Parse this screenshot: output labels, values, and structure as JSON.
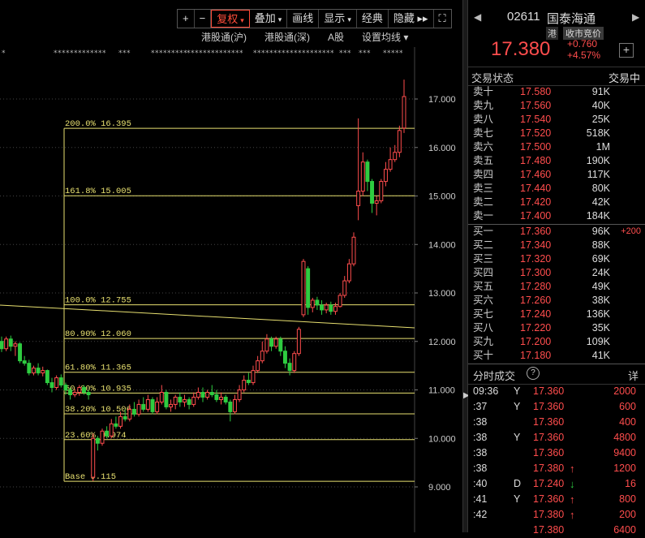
{
  "toolbar": {
    "items": [
      {
        "label": "+",
        "dropdown": false,
        "active": false,
        "name": "zoom-in-button"
      },
      {
        "label": "−",
        "dropdown": false,
        "active": false,
        "name": "zoom-out-button"
      },
      {
        "label": "复权",
        "dropdown": true,
        "active": true,
        "name": "adjust-button"
      },
      {
        "label": "叠加",
        "dropdown": true,
        "active": false,
        "name": "overlay-button"
      },
      {
        "label": "画线",
        "dropdown": false,
        "active": false,
        "name": "draw-button"
      },
      {
        "label": "显示",
        "dropdown": true,
        "active": false,
        "name": "display-button"
      },
      {
        "label": "经典",
        "dropdown": false,
        "active": false,
        "name": "classic-button"
      },
      {
        "label": "隐藏 ▸▸",
        "dropdown": false,
        "active": false,
        "name": "hide-button"
      },
      {
        "label": "⛶",
        "dropdown": false,
        "active": false,
        "name": "fullscreen-button"
      }
    ]
  },
  "subbar": {
    "items": [
      "港股通(沪)",
      "港股通(深)",
      "A股",
      "设置均线 ▾"
    ]
  },
  "chart_data": {
    "type": "candlestick",
    "ylim": [
      8.85,
      17.6
    ],
    "y_ticks": [
      "17.000",
      "16.000",
      "15.000",
      "14.000",
      "13.000",
      "12.000",
      "11.000",
      "10.000",
      "9.000"
    ],
    "fib_levels": [
      {
        "label": "200.0% 16.395",
        "value": 16.395
      },
      {
        "label": "161.8% 15.005",
        "value": 15.005
      },
      {
        "label": "100.0% 12.755",
        "value": 12.755
      },
      {
        "label": "80.90% 12.060",
        "value": 12.06
      },
      {
        "label": "61.80% 11.365",
        "value": 11.365
      },
      {
        "label": "50.00% 10.935",
        "value": 10.935
      },
      {
        "label": "38.20% 10.506",
        "value": 10.506
      },
      {
        "label": "23.60% 9.974",
        "value": 9.974
      },
      {
        "label": "Base   9.115",
        "value": 9.115
      }
    ],
    "trendline": {
      "from": 12.75,
      "to": 12.28
    },
    "candles": [
      [
        12.0,
        11.85,
        12.1,
        11.78
      ],
      [
        11.85,
        12.05,
        12.1,
        11.8
      ],
      [
        12.05,
        11.9,
        12.12,
        11.8
      ],
      [
        11.9,
        11.95,
        12.0,
        11.7
      ],
      [
        11.95,
        11.6,
        11.98,
        11.55
      ],
      [
        11.6,
        11.55,
        11.7,
        11.5
      ],
      [
        11.55,
        11.35,
        11.62,
        11.3
      ],
      [
        11.35,
        11.45,
        11.5,
        11.3
      ],
      [
        11.45,
        11.35,
        11.55,
        11.3
      ],
      [
        11.35,
        11.4,
        11.48,
        11.28
      ],
      [
        11.4,
        11.15,
        11.42,
        11.1
      ],
      [
        11.15,
        11.05,
        11.25,
        10.95
      ],
      [
        11.05,
        11.25,
        11.3,
        11.0
      ],
      [
        11.25,
        11.1,
        11.32,
        11.05
      ],
      [
        11.1,
        11.0,
        11.15,
        10.9
      ],
      [
        11.0,
        10.9,
        11.05,
        10.8
      ],
      [
        10.9,
        10.95,
        11.02,
        10.85
      ],
      [
        10.95,
        11.05,
        11.1,
        10.88
      ],
      [
        11.05,
        10.95,
        11.1,
        10.9
      ],
      [
        10.95,
        10.9,
        11.0,
        10.8
      ],
      [
        9.2,
        10.0,
        10.1,
        9.12
      ],
      [
        10.0,
        9.9,
        10.05,
        9.75
      ],
      [
        9.9,
        10.15,
        10.2,
        9.85
      ],
      [
        10.15,
        10.05,
        10.25,
        10.0
      ],
      [
        10.05,
        10.3,
        10.4,
        10.0
      ],
      [
        10.3,
        10.25,
        10.45,
        10.2
      ],
      [
        10.25,
        10.45,
        10.55,
        10.2
      ],
      [
        10.45,
        10.4,
        10.6,
        10.35
      ],
      [
        10.4,
        10.6,
        10.7,
        10.35
      ],
      [
        10.6,
        10.5,
        10.75,
        10.45
      ],
      [
        10.5,
        10.7,
        10.8,
        10.45
      ],
      [
        10.7,
        10.6,
        10.85,
        10.55
      ],
      [
        10.6,
        10.8,
        10.9,
        10.55
      ],
      [
        10.8,
        10.55,
        10.85,
        10.5
      ],
      [
        10.55,
        10.75,
        10.85,
        10.5
      ],
      [
        10.75,
        10.95,
        11.1,
        10.7
      ],
      [
        10.95,
        10.65,
        11.0,
        10.6
      ],
      [
        10.65,
        10.7,
        10.8,
        10.55
      ],
      [
        10.7,
        10.85,
        10.9,
        10.6
      ],
      [
        10.85,
        10.75,
        10.95,
        10.65
      ],
      [
        10.75,
        10.8,
        10.9,
        10.65
      ],
      [
        10.8,
        10.7,
        10.85,
        10.6
      ],
      [
        10.7,
        10.85,
        10.95,
        10.65
      ],
      [
        10.85,
        10.95,
        11.05,
        10.8
      ],
      [
        10.95,
        10.85,
        11.05,
        10.75
      ],
      [
        10.85,
        10.95,
        11.0,
        10.8
      ],
      [
        10.95,
        10.9,
        11.1,
        10.85
      ],
      [
        10.9,
        10.8,
        11.0,
        10.75
      ],
      [
        10.8,
        10.85,
        10.95,
        10.7
      ],
      [
        10.85,
        10.75,
        10.9,
        10.7
      ],
      [
        10.75,
        10.55,
        10.8,
        10.35
      ],
      [
        10.55,
        10.8,
        10.9,
        10.5
      ],
      [
        10.8,
        11.0,
        11.1,
        10.75
      ],
      [
        11.0,
        11.2,
        11.3,
        10.95
      ],
      [
        11.2,
        11.15,
        11.35,
        11.1
      ],
      [
        11.15,
        11.4,
        11.5,
        11.1
      ],
      [
        11.4,
        11.6,
        11.7,
        11.35
      ],
      [
        11.6,
        11.8,
        12.0,
        11.55
      ],
      [
        11.8,
        12.05,
        12.15,
        11.75
      ],
      [
        12.05,
        11.9,
        12.1,
        11.8
      ],
      [
        11.9,
        12.05,
        12.1,
        11.85
      ],
      [
        12.05,
        11.8,
        12.1,
        11.7
      ],
      [
        11.8,
        11.55,
        11.9,
        11.45
      ],
      [
        11.55,
        11.4,
        11.65,
        11.3
      ],
      [
        11.4,
        11.75,
        11.8,
        11.35
      ],
      [
        11.75,
        12.25,
        12.3,
        11.7
      ],
      [
        12.55,
        13.65,
        13.7,
        12.5
      ],
      [
        13.5,
        12.7,
        13.55,
        12.55
      ],
      [
        12.7,
        12.85,
        12.9,
        12.6
      ],
      [
        12.85,
        12.75,
        12.92,
        12.65
      ],
      [
        12.75,
        12.65,
        12.85,
        12.55
      ],
      [
        12.65,
        12.75,
        12.8,
        12.58
      ],
      [
        12.75,
        12.62,
        12.82,
        12.55
      ],
      [
        12.62,
        12.72,
        12.8,
        12.55
      ],
      [
        12.72,
        12.95,
        13.0,
        12.7
      ],
      [
        12.95,
        13.25,
        13.35,
        12.9
      ],
      [
        13.25,
        13.6,
        13.7,
        13.2
      ],
      [
        13.6,
        14.15,
        14.25,
        13.55
      ],
      [
        14.8,
        15.1,
        16.6,
        14.5
      ],
      [
        15.1,
        15.7,
        15.9,
        15.0
      ],
      [
        15.7,
        15.3,
        15.75,
        15.1
      ],
      [
        15.3,
        14.85,
        15.35,
        14.65
      ],
      [
        14.85,
        14.9,
        15.0,
        14.6
      ],
      [
        14.9,
        15.3,
        15.35,
        14.85
      ],
      [
        15.3,
        15.55,
        15.7,
        15.2
      ],
      [
        15.55,
        15.75,
        16.0,
        15.5
      ],
      [
        15.75,
        15.9,
        16.05,
        15.7
      ],
      [
        15.9,
        16.35,
        16.45,
        15.8
      ],
      [
        16.4,
        17.05,
        17.4,
        16.3
      ]
    ]
  },
  "quote": {
    "nav_prev": "◀",
    "nav_next": "▶",
    "code": "02611",
    "name": "国泰海通",
    "tag": "港",
    "tag2": "收市竞价",
    "price": "17.380",
    "change": "+0.760",
    "change_pct": "+4.57%",
    "add": "+",
    "status_label": "交易状态",
    "status_value": "交易中",
    "asks": [
      {
        "label": "卖十",
        "price": "17.580",
        "vol": "91K"
      },
      {
        "label": "卖九",
        "price": "17.560",
        "vol": "40K"
      },
      {
        "label": "卖八",
        "price": "17.540",
        "vol": "25K"
      },
      {
        "label": "卖七",
        "price": "17.520",
        "vol": "518K"
      },
      {
        "label": "卖六",
        "price": "17.500",
        "vol": "1M"
      },
      {
        "label": "卖五",
        "price": "17.480",
        "vol": "190K"
      },
      {
        "label": "卖四",
        "price": "17.460",
        "vol": "117K"
      },
      {
        "label": "卖三",
        "price": "17.440",
        "vol": "80K"
      },
      {
        "label": "卖二",
        "price": "17.420",
        "vol": "42K"
      },
      {
        "label": "卖一",
        "price": "17.400",
        "vol": "184K"
      }
    ],
    "bids": [
      {
        "label": "买一",
        "price": "17.360",
        "vol": "96K",
        "chg": "+200"
      },
      {
        "label": "买二",
        "price": "17.340",
        "vol": "88K",
        "chg": ""
      },
      {
        "label": "买三",
        "price": "17.320",
        "vol": "69K",
        "chg": ""
      },
      {
        "label": "买四",
        "price": "17.300",
        "vol": "24K",
        "chg": ""
      },
      {
        "label": "买五",
        "price": "17.280",
        "vol": "49K",
        "chg": ""
      },
      {
        "label": "买六",
        "price": "17.260",
        "vol": "38K",
        "chg": ""
      },
      {
        "label": "买七",
        "price": "17.240",
        "vol": "136K",
        "chg": ""
      },
      {
        "label": "买八",
        "price": "17.220",
        "vol": "35K",
        "chg": ""
      },
      {
        "label": "买九",
        "price": "17.200",
        "vol": "109K",
        "chg": ""
      },
      {
        "label": "买十",
        "price": "17.180",
        "vol": "41K",
        "chg": ""
      }
    ],
    "ticks_title": "分时成交",
    "ticks_info": "?",
    "ticks_detail": "详",
    "ticks": [
      {
        "time": "09:36",
        "dir": "Y",
        "price": "17.360",
        "arrow": "",
        "qty": "2000"
      },
      {
        "time": ":37",
        "dir": "Y",
        "price": "17.360",
        "arrow": "",
        "qty": "600"
      },
      {
        "time": ":38",
        "dir": "",
        "price": "17.360",
        "arrow": "",
        "qty": "400"
      },
      {
        "time": ":38",
        "dir": "Y",
        "price": "17.360",
        "arrow": "",
        "qty": "4800"
      },
      {
        "time": ":38",
        "dir": "",
        "price": "17.360",
        "arrow": "",
        "qty": "9400"
      },
      {
        "time": ":38",
        "dir": "",
        "price": "17.380",
        "arrow": "up",
        "qty": "1200"
      },
      {
        "time": ":40",
        "dir": "D",
        "price": "17.240",
        "arrow": "down",
        "qty": "16"
      },
      {
        "time": ":41",
        "dir": "Y",
        "price": "17.360",
        "arrow": "up",
        "qty": "800"
      },
      {
        "time": ":42",
        "dir": "",
        "price": "17.380",
        "arrow": "up",
        "qty": "200"
      },
      {
        "time": "",
        "dir": "",
        "price": "17.380",
        "arrow": "",
        "qty": "6400"
      }
    ],
    "colors": {
      "up": "#ff4d4d",
      "down": "#2ecc40",
      "fib": "#e8e070"
    }
  },
  "divider_handle": "▶"
}
